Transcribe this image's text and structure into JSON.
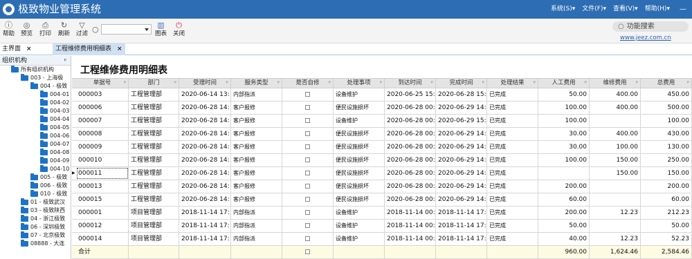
{
  "app": {
    "title": "极致物业管理系统"
  },
  "menu": {
    "items": [
      "系统(S)▾",
      "文件(F)▾",
      "查看(V)▾",
      "帮助(H)▾"
    ],
    "minimize": "—"
  },
  "toolbar": {
    "help": "帮助",
    "preview": "预览",
    "print": "打印",
    "refresh": "刷新",
    "filter": "过滤",
    "chart": "图表",
    "close": "关闭",
    "search_placeholder": "",
    "func_search": "功能搜索",
    "link": "www.jeez.com.cn"
  },
  "tabs": {
    "home": "主界面",
    "current": "工程维修费用明细表"
  },
  "sidebar": {
    "header": "组织机构",
    "items": [
      {
        "label": "所有组织机构",
        "level": 0
      },
      {
        "label": "003 - 上海极",
        "level": 1
      },
      {
        "label": "004 - 极致",
        "level": 2
      },
      {
        "label": "004-01",
        "level": 3
      },
      {
        "label": "004-02",
        "level": 3
      },
      {
        "label": "004-03",
        "level": 3
      },
      {
        "label": "004-04",
        "level": 3
      },
      {
        "label": "004-05",
        "level": 3
      },
      {
        "label": "004-06",
        "level": 3
      },
      {
        "label": "004-07",
        "level": 3
      },
      {
        "label": "004-08",
        "level": 3
      },
      {
        "label": "004-09",
        "level": 3
      },
      {
        "label": "004-10",
        "level": 3
      },
      {
        "label": "005 - 极致",
        "level": 2
      },
      {
        "label": "006 - 极致",
        "level": 2
      },
      {
        "label": "010 - 极致",
        "level": 2
      },
      {
        "label": "01 - 极致武汉",
        "level": 1
      },
      {
        "label": "03 - 极致陕西",
        "level": 1
      },
      {
        "label": "04 - 浙江极致",
        "level": 1
      },
      {
        "label": "06 - 深圳极致",
        "level": 1
      },
      {
        "label": "07 - 北京极致",
        "level": 1
      },
      {
        "label": "08888 - 大连",
        "level": 1
      }
    ]
  },
  "report": {
    "title": "工程维修费用明细表",
    "columns": [
      "单据号",
      "部门",
      "受理时间",
      "服务类型",
      "是否自修",
      "处理事项",
      "到达时间",
      "完成时间",
      "处理结果",
      "人工费用",
      "维修费用",
      "总费用"
    ],
    "rows": [
      [
        "000003",
        "工程管理部",
        "2020-06-14 13:",
        "内部指派",
        "",
        "设备维护",
        "2020-06-25 15:",
        "2020-06-28 15:",
        "已完成",
        "50.00",
        "400.00",
        "450.00"
      ],
      [
        "000006",
        "工程管理部",
        "2020-06-28 14:",
        "客户报修",
        "",
        "便民设施损坏",
        "2020-06-28 00:",
        "2020-06-29 14:",
        "已完成",
        "100.00",
        "400.00",
        "500.00"
      ],
      [
        "000007",
        "工程管理部",
        "2020-06-28 14:",
        "客户报修",
        "",
        "设备维护",
        "2020-06-28 00:",
        "2020-06-29 15:",
        "已完成",
        "100.00",
        "",
        "100.00"
      ],
      [
        "000008",
        "工程管理部",
        "2020-06-28 14:",
        "客户报修",
        "",
        "便民设施损坏",
        "2020-06-28 00:",
        "2020-06-29 14:",
        "已完成",
        "30.00",
        "400.00",
        "430.00"
      ],
      [
        "000009",
        "工程管理部",
        "2020-06-28 14:",
        "客户报修",
        "",
        "便民设施损坏",
        "2020-06-28 00:",
        "2020-06-29 14:",
        "已完成",
        "30.00",
        "100.00",
        "130.00"
      ],
      [
        "000010",
        "工程管理部",
        "2020-06-28 14:",
        "客户报修",
        "",
        "便民设施损坏",
        "2020-06-28 00:",
        "2020-06-29 14:",
        "已完成",
        "100.00",
        "150.00",
        "250.00"
      ],
      [
        "000011",
        "工程管理部",
        "2020-06-28 14:",
        "客户报修",
        "",
        "便民设施损坏",
        "2020-06-28 00:",
        "2020-06-29 14:",
        "已完成",
        "",
        "150.00",
        "150.00"
      ],
      [
        "000013",
        "工程管理部",
        "2020-06-28 14:",
        "客户报修",
        "",
        "便民设施损坏",
        "2020-06-28 00:",
        "2020-06-29 14:",
        "已完成",
        "200.00",
        "",
        "200.00"
      ],
      [
        "000015",
        "工程管理部",
        "2020-06-28 14:",
        "客户报修",
        "",
        "便民设施损坏",
        "2020-06-28 00:",
        "2020-06-29 14:",
        "已完成",
        "60.00",
        "",
        "60.00"
      ],
      [
        "000001",
        "项目管理部",
        "2018-11-14 17:",
        "内部指派",
        "",
        "设备维护",
        "2018-11-14 00:",
        "2018-11-14 17:",
        "已完成",
        "200.00",
        "12.23",
        "212.23"
      ],
      [
        "000012",
        "项目管理部",
        "2018-11-14 17:",
        "内部指派",
        "",
        "设备维护",
        "2018-11-14 00:",
        "2018-11-14 17:",
        "已完成",
        "50.00",
        "",
        "50.00"
      ],
      [
        "000014",
        "项目管理部",
        "2018-11-14 17:",
        "内部指派",
        "",
        "设备维护",
        "2018-11-14 00:",
        "2018-11-14 17:",
        "已完成",
        "40.00",
        "12.23",
        "52.23"
      ]
    ],
    "total": {
      "label": "合计",
      "labor": "960.00",
      "repair": "1,624.46",
      "sum": "2,584.46"
    }
  }
}
